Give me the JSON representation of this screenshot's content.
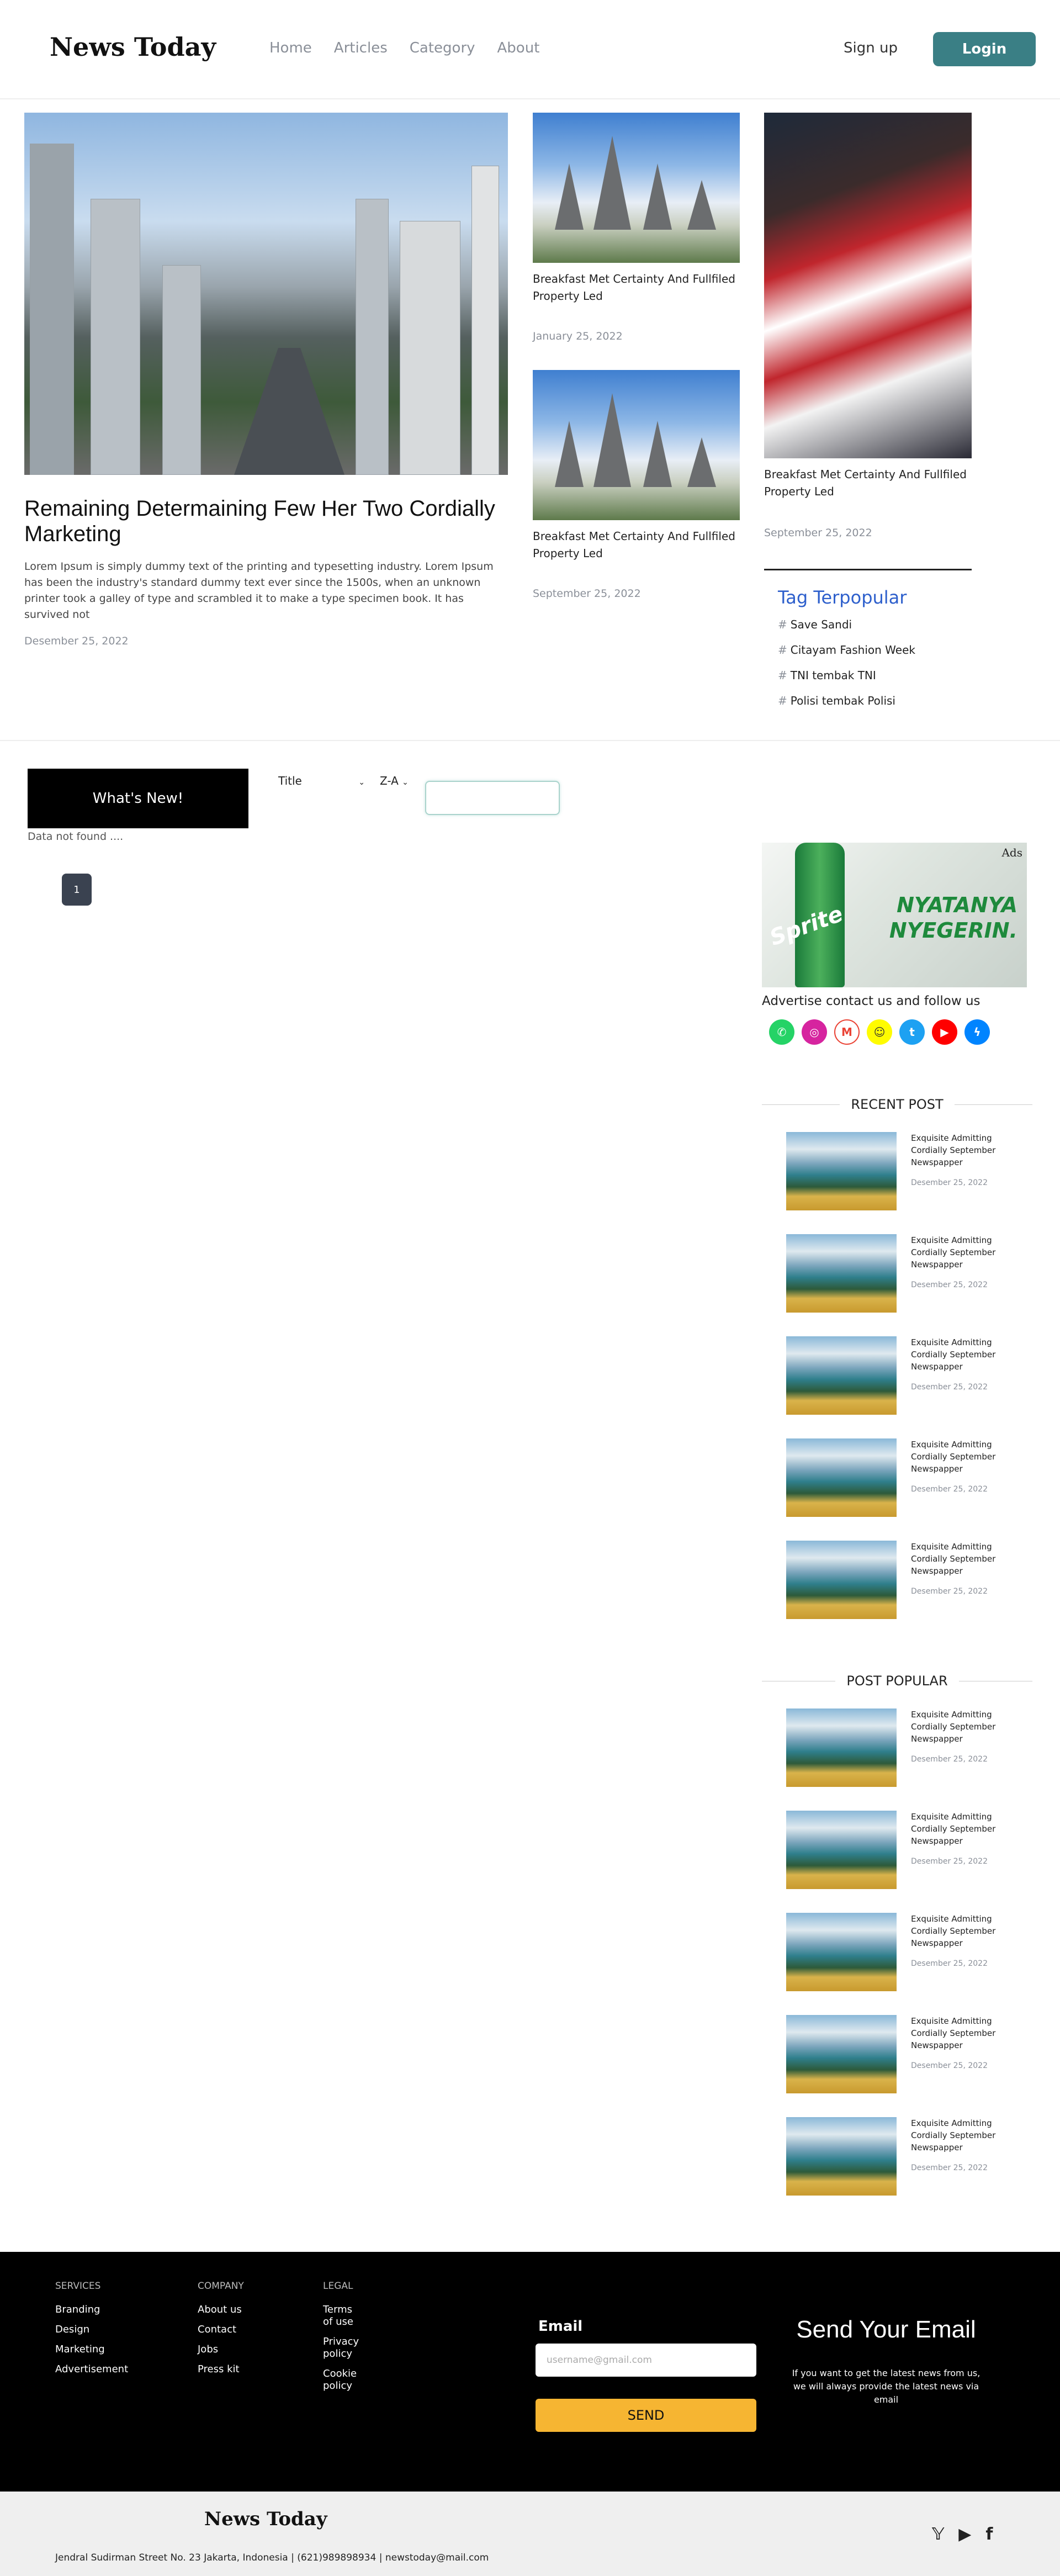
{
  "header": {
    "logo": "News Today",
    "nav": [
      "Home",
      "Articles",
      "Category",
      "About"
    ],
    "signup": "Sign up",
    "login": "Login"
  },
  "hero": {
    "title": "Remaining Determaining Few Her Two Cordially Marketing",
    "text": "Lorem Ipsum is simply dummy text of the printing and typesetting industry. Lorem Ipsum has been the industry's standard dummy text ever since the 1500s, when an unknown printer took a galley of type and scrambled it to make a type specimen book. It has survived not",
    "date": "Desember 25, 2022"
  },
  "cards": [
    {
      "title": "Breakfast Met Certainty And Fullfiled Property Led",
      "date": "January 25, 2022"
    },
    {
      "title": "Breakfast Met Certainty And Fullfiled Property Led",
      "date": "September 25, 2022"
    },
    {
      "title": "Breakfast Met Certainty And Fullfiled Property Led",
      "date": "September 25, 2022"
    }
  ],
  "tags": {
    "heading": "Tag Terpopular",
    "items": [
      "Save Sandi",
      "Citayam Fashion Week",
      "TNI tembak TNI",
      "Polisi tembak Polisi"
    ]
  },
  "filters": {
    "whats_new": "What's New!",
    "sort_by": "Title",
    "order": "Z-A",
    "no_data": "Data not found ....",
    "page": "1"
  },
  "ad": {
    "label": "Ads",
    "brand": "Sprite",
    "copy": "NYATANYA NYEGERIN.",
    "advertise": "Advertise contact us and follow us",
    "socials": [
      {
        "name": "whatsapp-icon",
        "color": "#25d366",
        "glyph": "✆"
      },
      {
        "name": "instagram-icon",
        "color": "#d6249f",
        "glyph": "◎"
      },
      {
        "name": "gmail-icon",
        "color": "#ea4335",
        "glyph": "M"
      },
      {
        "name": "snapchat-icon",
        "color": "#fffc00",
        "glyph": "☺"
      },
      {
        "name": "twitter-icon",
        "color": "#1da1f2",
        "glyph": "t"
      },
      {
        "name": "youtube-icon",
        "color": "#ff0000",
        "glyph": "▶"
      },
      {
        "name": "messenger-icon",
        "color": "#0084ff",
        "glyph": "ϟ"
      }
    ]
  },
  "recent": {
    "heading": "RECENT POST",
    "posts": [
      {
        "title": "Exquisite Admitting Cordially September Newspapper",
        "date": "Desember 25, 2022"
      },
      {
        "title": "Exquisite Admitting Cordially September Newspapper",
        "date": "Desember 25, 2022"
      },
      {
        "title": "Exquisite Admitting Cordially September Newspapper",
        "date": "Desember 25, 2022"
      },
      {
        "title": "Exquisite Admitting Cordially September Newspapper",
        "date": "Desember 25, 2022"
      },
      {
        "title": "Exquisite Admitting Cordially September Newspapper",
        "date": "Desember 25, 2022"
      }
    ]
  },
  "popular": {
    "heading": "POST POPULAR",
    "posts": [
      {
        "title": "Exquisite Admitting Cordially September Newspapper",
        "date": "Desember 25, 2022"
      },
      {
        "title": "Exquisite Admitting Cordially September Newspapper",
        "date": "Desember 25, 2022"
      },
      {
        "title": "Exquisite Admitting Cordially September Newspapper",
        "date": "Desember 25, 2022"
      },
      {
        "title": "Exquisite Admitting Cordially September Newspapper",
        "date": "Desember 25, 2022"
      },
      {
        "title": "Exquisite Admitting Cordially September Newspapper",
        "date": "Desember 25, 2022"
      }
    ]
  },
  "footer": {
    "services": {
      "heading": "SERVICES",
      "items": [
        "Branding",
        "Design",
        "Marketing",
        "Advertisement"
      ]
    },
    "company": {
      "heading": "COMPANY",
      "items": [
        "About us",
        "Contact",
        "Jobs",
        "Press kit"
      ]
    },
    "legal": {
      "heading": "LEGAL",
      "items": [
        "Terms of use",
        "Privacy policy",
        "Cookie policy"
      ]
    },
    "email_label": "Email",
    "email_placeholder": "username@gmail.com",
    "send_button": "SEND",
    "send_title": "Send Your Email",
    "send_text": "If you want to get the latest news from us, we will always provide the latest news via email"
  },
  "subfooter": {
    "logo": "News Today",
    "address": "Jendral Sudirman Street No. 23 Jakarta, Indonesia | (621)989898934 | newstoday@mail.com"
  }
}
